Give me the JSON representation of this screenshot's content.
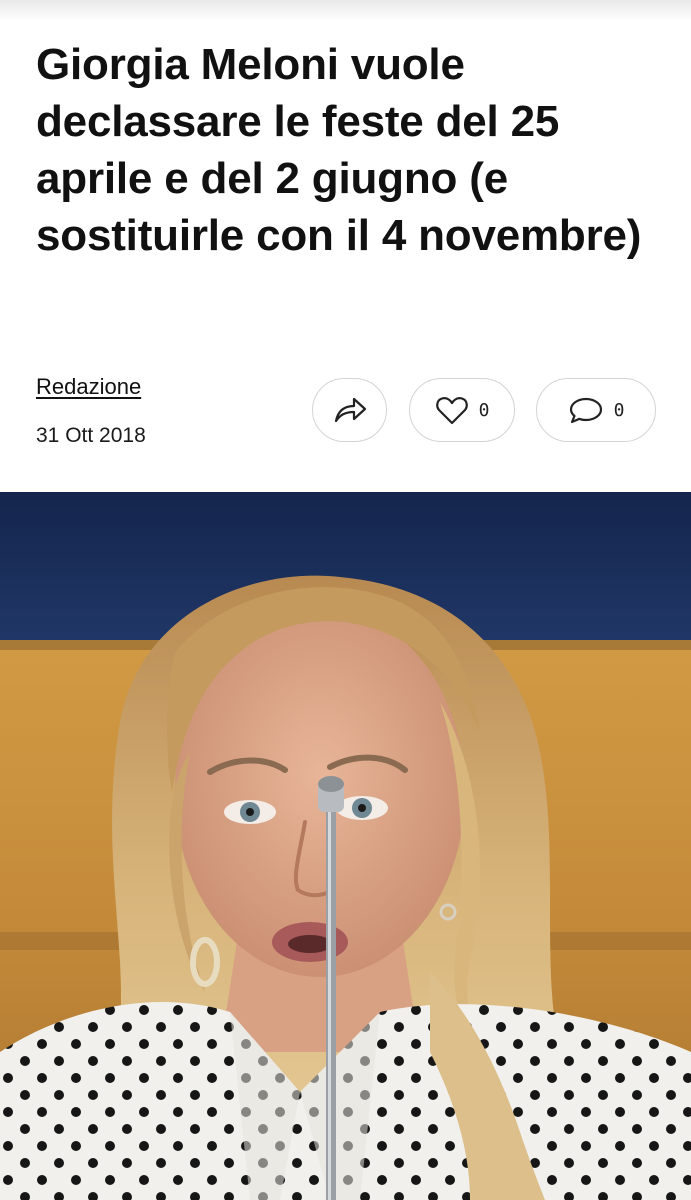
{
  "article": {
    "headline": "Giorgia Meloni vuole declassare le feste del 25 aprile e del 2 giugno (e sostituirle con il 4 novembre)",
    "author": "Redazione",
    "date": "31 Ott 2018"
  },
  "actions": {
    "share_icon": "share-arrow-icon",
    "like_icon": "heart-icon",
    "like_count": "0",
    "comment_icon": "speech-bubble-icon",
    "comment_count": "0"
  },
  "colors": {
    "text": "#111111",
    "button_border": "#d4d4d4",
    "photo_backdrop_blue": "#1c2f5c",
    "photo_backdrop_wood": "#c9933f"
  }
}
